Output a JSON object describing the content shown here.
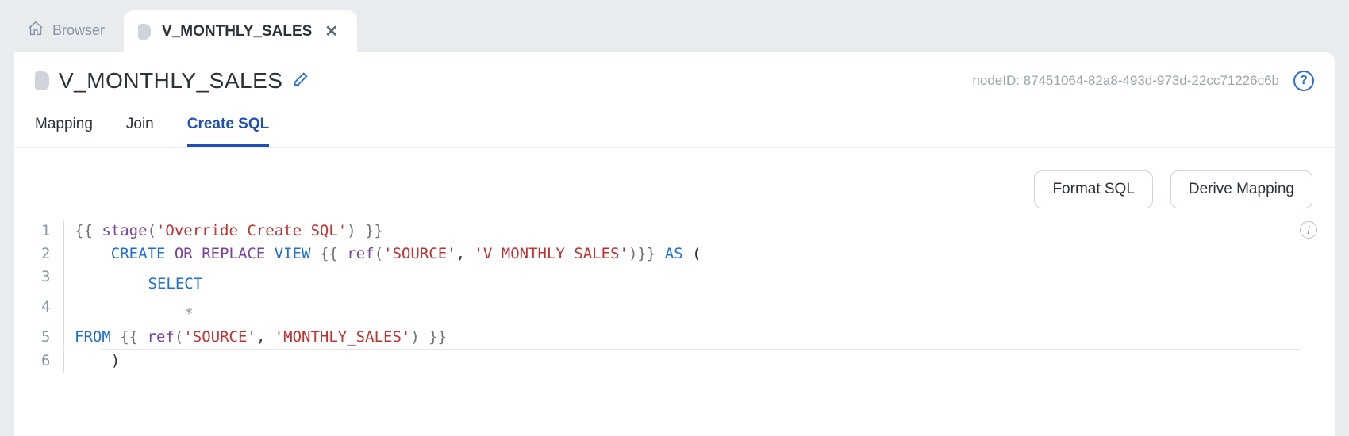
{
  "tabs": {
    "browser_label": "Browser",
    "active_label": "V_MONTHLY_SALES"
  },
  "header": {
    "title": "V_MONTHLY_SALES",
    "node_id": "nodeID: 87451064-82a8-493d-973d-22cc71226c6b"
  },
  "subtabs": {
    "mapping": "Mapping",
    "join": "Join",
    "create_sql": "Create SQL"
  },
  "toolbar": {
    "format_sql": "Format SQL",
    "derive_mapping": "Derive Mapping"
  },
  "lines": {
    "n1": "1",
    "n2": "2",
    "n3": "3",
    "n4": "4",
    "n5": "5",
    "n6": "6"
  },
  "code": {
    "l1_open": "{{ ",
    "l1_func": "stage",
    "l1_paren_open": "(",
    "l1_str": "'Override Create SQL'",
    "l1_paren_close": ")",
    "l1_close": " }}",
    "l2_indent": "    ",
    "l2_create": "CREATE",
    "l2_sp1": " ",
    "l2_or": "OR",
    "l2_sp2": " ",
    "l2_replace": "REPLACE",
    "l2_sp3": " ",
    "l2_view": "VIEW",
    "l2_sp4": " ",
    "l2_open": "{{ ",
    "l2_ref": "ref",
    "l2_paren_open": "(",
    "l2_arg1": "'SOURCE'",
    "l2_comma": ", ",
    "l2_arg2": "'V_MONTHLY_SALES'",
    "l2_paren_close": ")",
    "l2_close": "}}",
    "l2_sp5": " ",
    "l2_as": "AS",
    "l2_sp6": " (",
    "l3_indent": "        ",
    "l3_select": "SELECT",
    "l4_indent": "            ",
    "l4_star": "*",
    "l5_from": "FROM",
    "l5_sp": " ",
    "l5_open": "{{ ",
    "l5_ref": "ref",
    "l5_paren_open": "(",
    "l5_arg1": "'SOURCE'",
    "l5_comma": ", ",
    "l5_arg2": "'MONTHLY_SALES'",
    "l5_paren_close": ")",
    "l5_close": " }}",
    "l6_indent": "    ",
    "l6_paren": ")"
  }
}
